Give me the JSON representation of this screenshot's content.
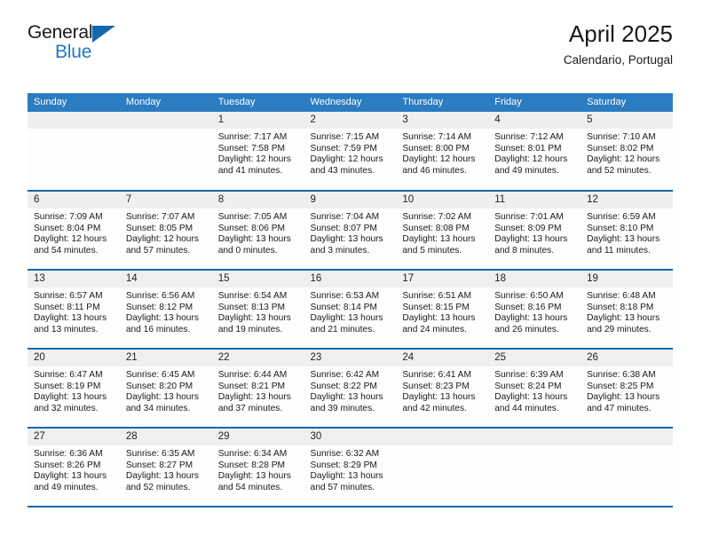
{
  "brand": {
    "name_top": "General",
    "name_bottom": "Blue",
    "triangle_color": "#1567b0",
    "blue_text_color": "#1f79c9"
  },
  "header": {
    "title": "April 2025",
    "subtitle": "Calendario, Portugal"
  },
  "theme": {
    "header_blue": "#2b7cc0",
    "row_separator_blue": "#1567b0",
    "daynum_band": "#efefef"
  },
  "weekdays": [
    "Sunday",
    "Monday",
    "Tuesday",
    "Wednesday",
    "Thursday",
    "Friday",
    "Saturday"
  ],
  "labels": {
    "sunrise_prefix": "Sunrise:",
    "sunset_prefix": "Sunset:",
    "daylight_prefix": "Daylight:"
  },
  "weeks": [
    [
      {
        "day": "",
        "empty": true
      },
      {
        "day": "",
        "empty": true
      },
      {
        "day": "1",
        "sunrise": "Sunrise: 7:17 AM",
        "sunset": "Sunset: 7:58 PM",
        "daylight": "Daylight: 12 hours and 41 minutes."
      },
      {
        "day": "2",
        "sunrise": "Sunrise: 7:15 AM",
        "sunset": "Sunset: 7:59 PM",
        "daylight": "Daylight: 12 hours and 43 minutes."
      },
      {
        "day": "3",
        "sunrise": "Sunrise: 7:14 AM",
        "sunset": "Sunset: 8:00 PM",
        "daylight": "Daylight: 12 hours and 46 minutes."
      },
      {
        "day": "4",
        "sunrise": "Sunrise: 7:12 AM",
        "sunset": "Sunset: 8:01 PM",
        "daylight": "Daylight: 12 hours and 49 minutes."
      },
      {
        "day": "5",
        "sunrise": "Sunrise: 7:10 AM",
        "sunset": "Sunset: 8:02 PM",
        "daylight": "Daylight: 12 hours and 52 minutes."
      }
    ],
    [
      {
        "day": "6",
        "sunrise": "Sunrise: 7:09 AM",
        "sunset": "Sunset: 8:04 PM",
        "daylight": "Daylight: 12 hours and 54 minutes."
      },
      {
        "day": "7",
        "sunrise": "Sunrise: 7:07 AM",
        "sunset": "Sunset: 8:05 PM",
        "daylight": "Daylight: 12 hours and 57 minutes."
      },
      {
        "day": "8",
        "sunrise": "Sunrise: 7:05 AM",
        "sunset": "Sunset: 8:06 PM",
        "daylight": "Daylight: 13 hours and 0 minutes."
      },
      {
        "day": "9",
        "sunrise": "Sunrise: 7:04 AM",
        "sunset": "Sunset: 8:07 PM",
        "daylight": "Daylight: 13 hours and 3 minutes."
      },
      {
        "day": "10",
        "sunrise": "Sunrise: 7:02 AM",
        "sunset": "Sunset: 8:08 PM",
        "daylight": "Daylight: 13 hours and 5 minutes."
      },
      {
        "day": "11",
        "sunrise": "Sunrise: 7:01 AM",
        "sunset": "Sunset: 8:09 PM",
        "daylight": "Daylight: 13 hours and 8 minutes."
      },
      {
        "day": "12",
        "sunrise": "Sunrise: 6:59 AM",
        "sunset": "Sunset: 8:10 PM",
        "daylight": "Daylight: 13 hours and 11 minutes."
      }
    ],
    [
      {
        "day": "13",
        "sunrise": "Sunrise: 6:57 AM",
        "sunset": "Sunset: 8:11 PM",
        "daylight": "Daylight: 13 hours and 13 minutes."
      },
      {
        "day": "14",
        "sunrise": "Sunrise: 6:56 AM",
        "sunset": "Sunset: 8:12 PM",
        "daylight": "Daylight: 13 hours and 16 minutes."
      },
      {
        "day": "15",
        "sunrise": "Sunrise: 6:54 AM",
        "sunset": "Sunset: 8:13 PM",
        "daylight": "Daylight: 13 hours and 19 minutes."
      },
      {
        "day": "16",
        "sunrise": "Sunrise: 6:53 AM",
        "sunset": "Sunset: 8:14 PM",
        "daylight": "Daylight: 13 hours and 21 minutes."
      },
      {
        "day": "17",
        "sunrise": "Sunrise: 6:51 AM",
        "sunset": "Sunset: 8:15 PM",
        "daylight": "Daylight: 13 hours and 24 minutes."
      },
      {
        "day": "18",
        "sunrise": "Sunrise: 6:50 AM",
        "sunset": "Sunset: 8:16 PM",
        "daylight": "Daylight: 13 hours and 26 minutes."
      },
      {
        "day": "19",
        "sunrise": "Sunrise: 6:48 AM",
        "sunset": "Sunset: 8:18 PM",
        "daylight": "Daylight: 13 hours and 29 minutes."
      }
    ],
    [
      {
        "day": "20",
        "sunrise": "Sunrise: 6:47 AM",
        "sunset": "Sunset: 8:19 PM",
        "daylight": "Daylight: 13 hours and 32 minutes."
      },
      {
        "day": "21",
        "sunrise": "Sunrise: 6:45 AM",
        "sunset": "Sunset: 8:20 PM",
        "daylight": "Daylight: 13 hours and 34 minutes."
      },
      {
        "day": "22",
        "sunrise": "Sunrise: 6:44 AM",
        "sunset": "Sunset: 8:21 PM",
        "daylight": "Daylight: 13 hours and 37 minutes."
      },
      {
        "day": "23",
        "sunrise": "Sunrise: 6:42 AM",
        "sunset": "Sunset: 8:22 PM",
        "daylight": "Daylight: 13 hours and 39 minutes."
      },
      {
        "day": "24",
        "sunrise": "Sunrise: 6:41 AM",
        "sunset": "Sunset: 8:23 PM",
        "daylight": "Daylight: 13 hours and 42 minutes."
      },
      {
        "day": "25",
        "sunrise": "Sunrise: 6:39 AM",
        "sunset": "Sunset: 8:24 PM",
        "daylight": "Daylight: 13 hours and 44 minutes."
      },
      {
        "day": "26",
        "sunrise": "Sunrise: 6:38 AM",
        "sunset": "Sunset: 8:25 PM",
        "daylight": "Daylight: 13 hours and 47 minutes."
      }
    ],
    [
      {
        "day": "27",
        "sunrise": "Sunrise: 6:36 AM",
        "sunset": "Sunset: 8:26 PM",
        "daylight": "Daylight: 13 hours and 49 minutes."
      },
      {
        "day": "28",
        "sunrise": "Sunrise: 6:35 AM",
        "sunset": "Sunset: 8:27 PM",
        "daylight": "Daylight: 13 hours and 52 minutes."
      },
      {
        "day": "29",
        "sunrise": "Sunrise: 6:34 AM",
        "sunset": "Sunset: 8:28 PM",
        "daylight": "Daylight: 13 hours and 54 minutes."
      },
      {
        "day": "30",
        "sunrise": "Sunrise: 6:32 AM",
        "sunset": "Sunset: 8:29 PM",
        "daylight": "Daylight: 13 hours and 57 minutes."
      },
      {
        "day": "",
        "empty": true
      },
      {
        "day": "",
        "empty": true
      },
      {
        "day": "",
        "empty": true
      }
    ]
  ]
}
